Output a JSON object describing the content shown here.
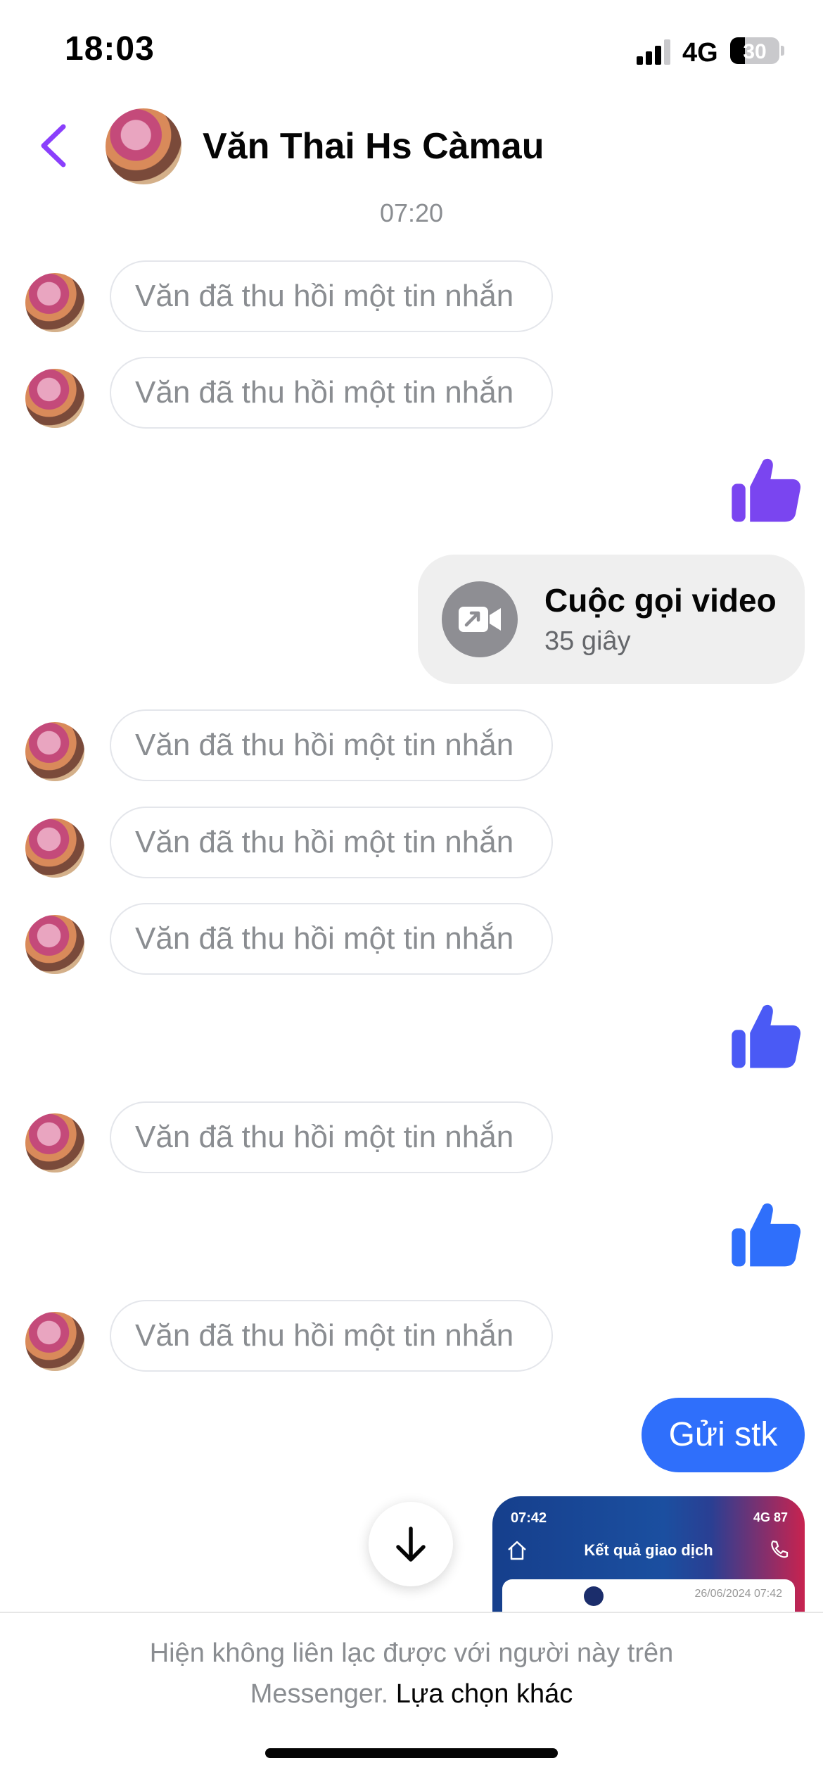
{
  "status_bar": {
    "time": "18:03",
    "network": "4G",
    "battery": "30",
    "battery_level": 0.3
  },
  "header": {
    "contact_name": "Văn Thai Hs Càmau"
  },
  "conversation": {
    "timestamp": "07:20",
    "unsent_text": "Văn đã thu hồi một tin nhắn",
    "video_call": {
      "title": "Cuộc gọi video",
      "duration": "35 giây"
    },
    "sent_message": "Gửi stk",
    "like_colors": [
      "#7a45f0",
      "#4a5af5",
      "#2f6ffb"
    ],
    "receipt_preview": {
      "time": "07:42",
      "status": "4G 87",
      "title": "Kết quả giao dịch",
      "date": "26/06/2024 07:42"
    }
  },
  "footer": {
    "notice_text": "Hiện không liên lạc được với người này trên",
    "notice_text_2": "Messenger.",
    "notice_link": "Lựa chọn khác"
  },
  "colors": {
    "accent": "#8a3ffc",
    "sent_bubble": "#2f6ffb",
    "muted_text": "#8a8d91"
  }
}
